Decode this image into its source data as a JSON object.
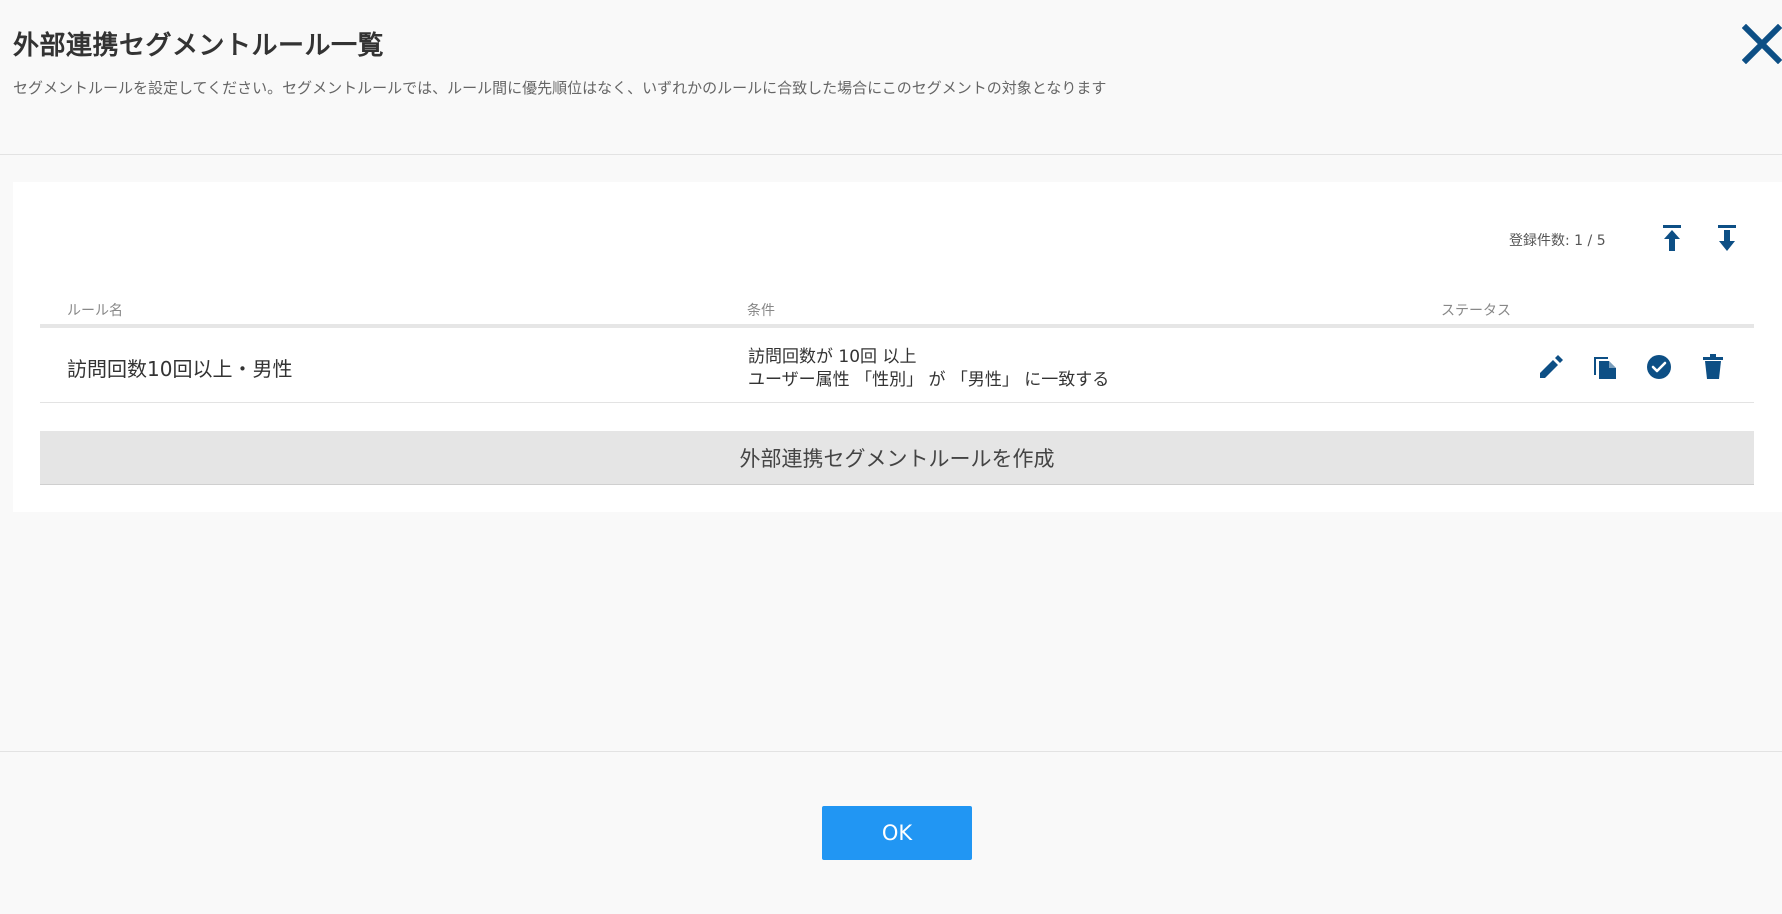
{
  "header": {
    "title": "外部連携セグメントルール一覧",
    "subtitle": "セグメントルールを設定してください。セグメントルールでは、ルール間に優先順位はなく、いずれかのルールに合致した場合にこのセグメントの対象となります"
  },
  "list": {
    "count_text": "登録件数: 1 / 5",
    "columns": [
      "ルール名",
      "条件",
      "ステータス"
    ],
    "rows": [
      {
        "name": "訪問回数10回以上・男性",
        "conditions": [
          "訪問回数が 10回 以上",
          "ユーザー属性 「性別」 が 「男性」 に一致する"
        ]
      }
    ],
    "create_label": "外部連携セグメントルールを作成"
  },
  "footer": {
    "ok_label": "OK"
  },
  "icons": {
    "close": "close-icon",
    "move_top": "move-to-top-icon",
    "move_bottom": "move-to-bottom-icon",
    "edit": "pencil-icon",
    "copy": "copy-icon",
    "status": "check-circle-icon",
    "delete": "trash-icon"
  },
  "colors": {
    "icon": "#0d4f85",
    "primary": "#2196f3",
    "create_bg": "#e5e5e5"
  }
}
